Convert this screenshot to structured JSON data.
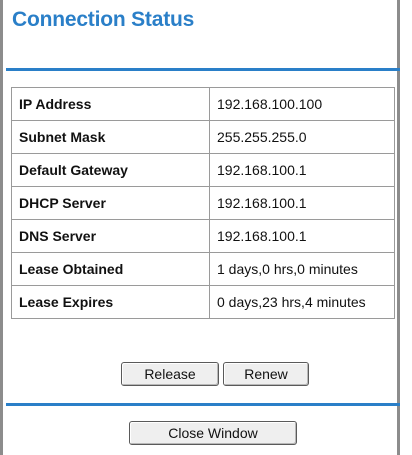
{
  "title": "Connection Status",
  "rows": [
    {
      "label": "IP Address",
      "value": "192.168.100.100"
    },
    {
      "label": "Subnet Mask",
      "value": "255.255.255.0"
    },
    {
      "label": "Default Gateway",
      "value": "192.168.100.1"
    },
    {
      "label": "DHCP Server",
      "value": "192.168.100.1"
    },
    {
      "label": "DNS Server",
      "value": "192.168.100.1"
    },
    {
      "label": "Lease Obtained",
      "value": "1 days,0 hrs,0 minutes"
    },
    {
      "label": "Lease Expires",
      "value": "0 days,23 hrs,4 minutes"
    }
  ],
  "buttons": {
    "release": "Release",
    "renew": "Renew",
    "close": "Close Window"
  },
  "colors": {
    "accent": "#2a7fc8",
    "border": "#8c8c8c"
  }
}
